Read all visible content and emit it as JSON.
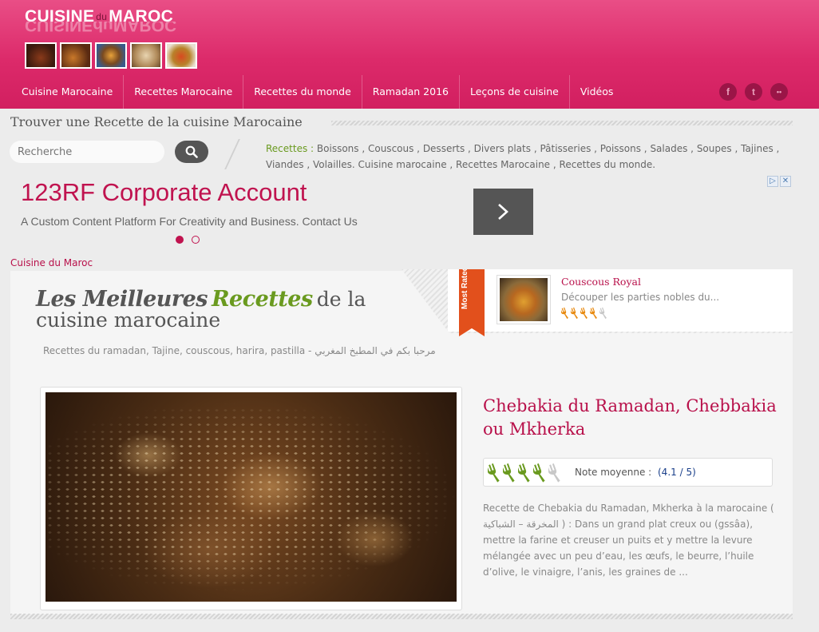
{
  "header": {
    "logo": {
      "part1": "CUISINE",
      "du": "du",
      "part2": "MAROC"
    },
    "thumbnails": [
      "tajine",
      "brochettes",
      "couscous",
      "pastilla",
      "harira"
    ],
    "colors": {
      "brand": "#dc2a6a",
      "accent_text": "#b8104a",
      "green": "#6a9a1f"
    }
  },
  "nav": {
    "items": [
      {
        "label": "Cuisine Marocaine"
      },
      {
        "label": "Recettes Marocaine"
      },
      {
        "label": "Recettes du monde"
      },
      {
        "label": "Ramadan 2016"
      },
      {
        "label": "Leçons de cuisine"
      },
      {
        "label": "Vidéos"
      }
    ],
    "social": [
      {
        "icon": "facebook-icon",
        "glyph": "f"
      },
      {
        "icon": "twitter-icon",
        "glyph": "t"
      },
      {
        "icon": "flickr-icon",
        "glyph": "••"
      }
    ]
  },
  "search": {
    "title": "Trouver une Recette de la cuisine Marocaine",
    "placeholder": "Recherche",
    "button_icon": "search-icon"
  },
  "recipe_links": {
    "label": "Recettes :",
    "items": [
      "Boissons",
      "Couscous",
      "Desserts",
      "Divers plats",
      "Pâtisseries",
      "Poissons",
      "Salades",
      "Soupes",
      "Tajines",
      "Viandes",
      "Volailles"
    ],
    "tail": [
      "Cuisine marocaine",
      "Recettes Marocaine",
      "Recettes du monde."
    ]
  },
  "ad": {
    "title": "123RF Corporate Account",
    "subtitle": "A Custom Content Platform For Creativity and Business. Contact Us",
    "slide_count": 2,
    "active_slide": 1,
    "choices_icons": [
      "adchoices-icon",
      "close-icon"
    ]
  },
  "breadcrumb": "Cuisine du Maroc",
  "hero": {
    "script_word1": "Les Meilleures",
    "script_word2": "Recettes",
    "line1_rest": "de la",
    "line2": "cuisine marocaine",
    "tagline": "Recettes du ramadan, Tajine, couscous, harira, pastilla - مرحبا بكم في المطبخ المغربي"
  },
  "most_rated": {
    "ribbon": "Most Rated",
    "title": "Couscous Royal",
    "description": "Découper les parties nobles du...",
    "rating_forks_filled": 4,
    "rating_forks_total": 5
  },
  "featured": {
    "title": "Chebakia du Ramadan, Chebbakia ou Mkherka",
    "rating_label": "Note moyenne :",
    "rating_value": "(4.1 / 5)",
    "rating_forks_filled": 4,
    "rating_forks_total": 5,
    "excerpt": "Recette de Chebakia du Ramadan, Mkherka à la marocaine ( المخرقة – الشباكية ) : Dans un grand plat creux ou (gssâa), mettre la farine et creuser un puits et y mettre la levure mélangée avec un peu d’eau, les œufs, le beurre, l’huile d’olive, le vinaigre, l’anis, les graines de ..."
  }
}
